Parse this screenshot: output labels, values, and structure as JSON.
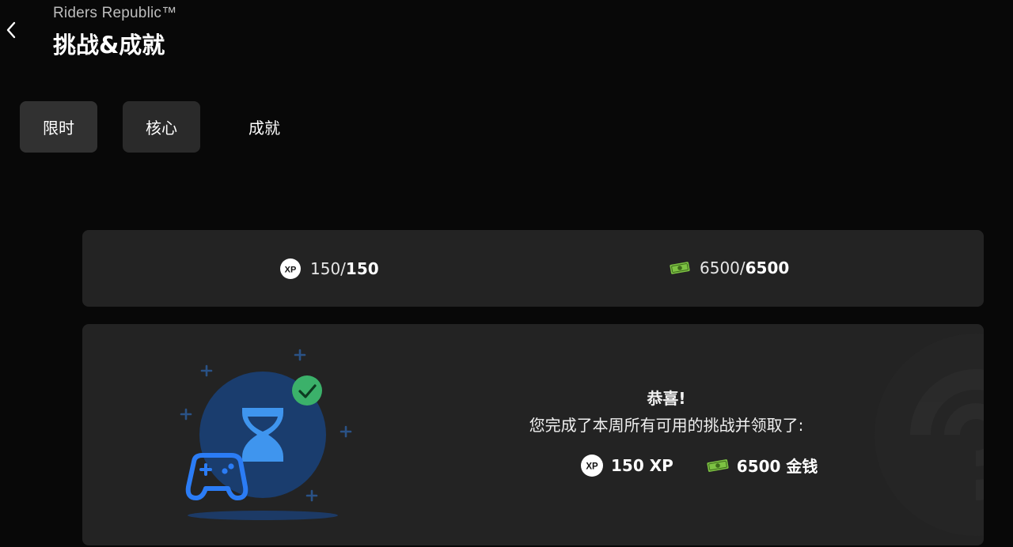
{
  "header": {
    "subtitle": "Riders Republic™",
    "title": "挑战&成就"
  },
  "tabs": [
    {
      "label": "限时",
      "active": true
    },
    {
      "label": "核心",
      "active": false
    },
    {
      "label": "成就",
      "active": false
    }
  ],
  "stats": {
    "xp": {
      "current": "150/",
      "max": "150"
    },
    "money": {
      "current": "6500/",
      "max": "6500"
    }
  },
  "completion": {
    "title": "恭喜!",
    "body": "您完成了本周所有可用的挑战并领取了:",
    "rewards": [
      {
        "label": "150 XP",
        "icon": "xp-icon"
      },
      {
        "label": "6500 金钱",
        "icon": "money-icon"
      }
    ]
  },
  "colors": {
    "background": "#080808",
    "card": "#232323",
    "tab_bg": "#2a2a2a",
    "accent_blue": "#2b7cf5",
    "success_green": "#3bb16a",
    "money_green": "#7dc243"
  }
}
